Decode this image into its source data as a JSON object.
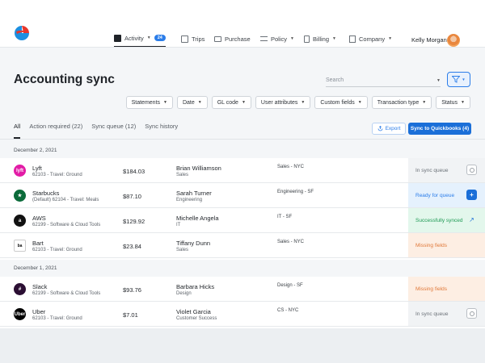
{
  "nav": {
    "activity": {
      "label": "Activity",
      "badge": "24"
    },
    "trips": "Trips",
    "purchase": "Purchase",
    "policy": "Policy",
    "billing": "Billing",
    "company": "Company",
    "user_name": "Kelly Morgan"
  },
  "header": {
    "title": "Accounting sync",
    "search_placeholder": "Search"
  },
  "filters": [
    "Statements",
    "Date",
    "GL code",
    "User attributes",
    "Custom fields",
    "Transaction type",
    "Status"
  ],
  "tabs": [
    "All",
    "Action required (22)",
    "Sync queue (12)",
    "Sync history"
  ],
  "actions": {
    "export": "Export",
    "sync": "Sync to Quickbooks (4)"
  },
  "groups": [
    {
      "date": "December 2, 2021"
    },
    {
      "date": "December 1, 2021"
    }
  ],
  "rows": [
    {
      "merchant": "Lyft",
      "sub": "62103 - Travel: Ground",
      "amount": "$184.03",
      "person": "Brian Williamson",
      "dept": "Sales",
      "location": "Sales - NYC",
      "status": "In sync queue",
      "status_type": "queue",
      "logo_color": "#e21ca6",
      "logo_text": "lyft"
    },
    {
      "merchant": "Starbucks",
      "sub": "(Default) 62104 - Travel: Meals",
      "amount": "$87.10",
      "person": "Sarah Turner",
      "dept": "Engineering",
      "location": "Engineering - SF",
      "status": "Ready for queue",
      "status_type": "ready",
      "logo_color": "#0b6b3a",
      "logo_text": "★"
    },
    {
      "merchant": "AWS",
      "sub": "62199 - Software & Cloud Tools",
      "amount": "$129.92",
      "person": "Michelle Angela",
      "dept": "IT",
      "location": "IT - SF",
      "status": "Successfully synced",
      "status_type": "synced",
      "logo_color": "#111111",
      "logo_text": "a"
    },
    {
      "merchant": "Bart",
      "sub": "62103 - Travel: Ground",
      "amount": "$23.84",
      "person": "Tiffany Dunn",
      "dept": "Sales",
      "location": "Sales - NYC",
      "status": "Missing fields",
      "status_type": "missing",
      "logo_color": "#ffffff",
      "logo_text": "ba"
    },
    {
      "merchant": "Slack",
      "sub": "62199 - Software & Cloud Tools",
      "amount": "$93.76",
      "person": "Barbara Hicks",
      "dept": "Design",
      "location": "Design - SF",
      "status": "Missing fields",
      "status_type": "missing",
      "logo_color": "#2b0f33",
      "logo_text": "#"
    },
    {
      "merchant": "Uber",
      "sub": "62103 - Travel: Ground",
      "amount": "$7.01",
      "person": "Violet Garcia",
      "dept": "Customer Success",
      "location": "CS - NYC",
      "status": "In sync queue",
      "status_type": "queue",
      "logo_color": "#000000",
      "logo_text": "Uber"
    }
  ],
  "colors": {
    "accent": "#1b6fd8",
    "queue_bg": "#f1f3f5",
    "ready_bg": "#e5f1fd",
    "synced_bg": "#e3f7ec",
    "missing_bg": "#fdeee3"
  }
}
